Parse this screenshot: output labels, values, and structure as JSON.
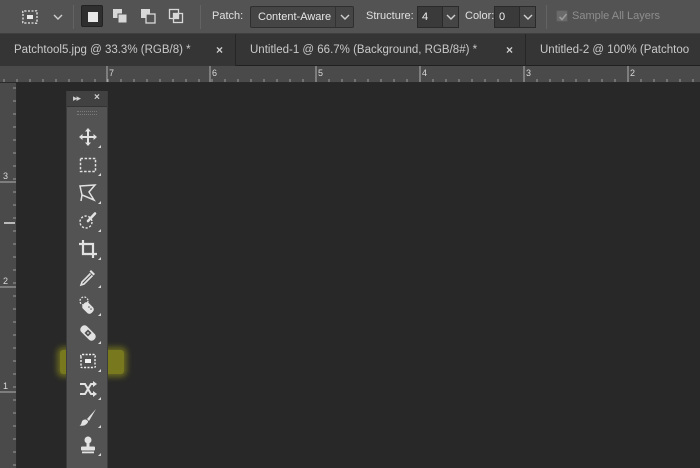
{
  "options_bar": {
    "patch_label": "Patch:",
    "patch_value": "Content-Aware",
    "structure_label": "Structure:",
    "structure_value": "4",
    "color_label": "Color:",
    "color_value": "0",
    "sample_all_layers_label": "Sample All Layers",
    "sample_all_layers_checked": true
  },
  "tabs": [
    {
      "title": "Patchtool5.jpg @ 33.3% (RGB/8) *",
      "close": "×"
    },
    {
      "title": "Untitled-1 @ 66.7% (Background, RGB/8#) *",
      "close": "×"
    },
    {
      "title": "Untitled-2 @ 100% (Patchtoo",
      "close": ""
    }
  ],
  "ruler_top_labels": [
    "7",
    "6",
    "5",
    "4",
    "3",
    "2"
  ],
  "ruler_left_labels": [
    "3",
    "2",
    "1"
  ],
  "tools_panel": {
    "collapse_glyph": "▸▸",
    "close_glyph": "×",
    "tools": [
      {
        "name": "move-tool",
        "icon": "move-icon"
      },
      {
        "name": "marquee-tool",
        "icon": "rectangular-marquee-icon"
      },
      {
        "name": "lasso-tool",
        "icon": "polygonal-lasso-icon"
      },
      {
        "name": "quick-selection-tool",
        "icon": "quick-selection-icon"
      },
      {
        "name": "crop-tool",
        "icon": "crop-icon"
      },
      {
        "name": "eyedropper-tool",
        "icon": "eyedropper-icon"
      },
      {
        "name": "spot-healing-tool",
        "icon": "spot-healing-brush-icon"
      },
      {
        "name": "healing-brush-tool",
        "icon": "healing-brush-icon"
      },
      {
        "name": "patch-tool",
        "icon": "patch-icon",
        "highlighted": true
      },
      {
        "name": "content-aware-move-tool",
        "icon": "content-aware-move-icon"
      },
      {
        "name": "brush-tool",
        "icon": "brush-icon"
      },
      {
        "name": "clone-stamp-tool",
        "icon": "clone-stamp-icon"
      }
    ]
  },
  "colors": {
    "options_bar_bg": "#535353",
    "tab_bar_bg": "#353535",
    "canvas_bg": "#282828",
    "highlight": "#e6e614"
  }
}
